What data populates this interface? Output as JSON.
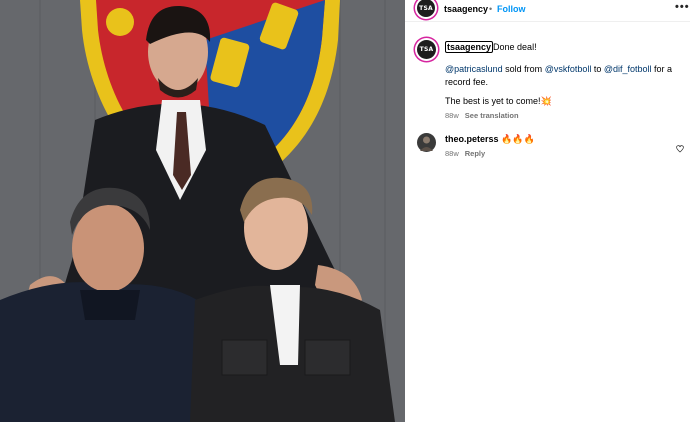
{
  "post": {
    "author": "tsaagency",
    "avatar_text": "TSA",
    "separator": "•",
    "follow_label": "Follow",
    "more_icon": "more-horizontal-icon"
  },
  "caption": {
    "author": "tsaagency",
    "lead": "Done deal!",
    "mention_player": "@patricaslund",
    "text_sold_from": " sold from ",
    "mention_club_from": "@vskfotboll",
    "text_to": " to ",
    "mention_club_to": "@dif_fotboll",
    "text_end": " for a record fee.",
    "line2": "The best is yet to come!",
    "emoji": "💥",
    "age": "88w",
    "see_translation": "See translation"
  },
  "comments": [
    {
      "author": "theo.peterss",
      "text": "🔥🔥🔥",
      "age": "88w",
      "reply_label": "Reply"
    }
  ],
  "colors": {
    "accent": "#0095f6",
    "link": "#00376b",
    "muted": "#737373"
  }
}
